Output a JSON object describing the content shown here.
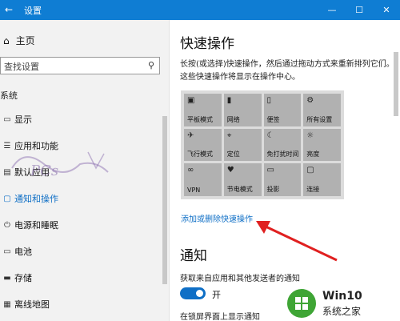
{
  "window": {
    "title": "设置",
    "controls": {
      "minimize": "—",
      "maximize": "☐",
      "close": "✕"
    }
  },
  "sidebar": {
    "home_label": "主页",
    "search_placeholder": "查找设置",
    "group_title": "系统",
    "items": [
      {
        "label": "显示",
        "icon": "display-icon"
      },
      {
        "label": "应用和功能",
        "icon": "apps-icon"
      },
      {
        "label": "默认应用",
        "icon": "default-apps-icon"
      },
      {
        "label": "通知和操作",
        "icon": "notifications-icon",
        "active": true
      },
      {
        "label": "电源和睡眠",
        "icon": "power-icon"
      },
      {
        "label": "电池",
        "icon": "battery-icon"
      },
      {
        "label": "存储",
        "icon": "storage-icon"
      },
      {
        "label": "离线地图",
        "icon": "maps-icon"
      }
    ]
  },
  "main": {
    "quick_actions_title": "快速操作",
    "quick_actions_desc": "长按(或选择)快速操作，然后通过拖动方式来重新排列它们。这些快速操作将显示在操作中心。",
    "tiles": [
      {
        "label": "平板模式",
        "icon": "tablet-icon"
      },
      {
        "label": "网络",
        "icon": "network-icon"
      },
      {
        "label": "便签",
        "icon": "note-icon"
      },
      {
        "label": "所有设置",
        "icon": "gear-icon"
      },
      {
        "label": "飞行模式",
        "icon": "airplane-icon"
      },
      {
        "label": "定位",
        "icon": "location-icon"
      },
      {
        "label": "免打扰时间",
        "icon": "moon-icon"
      },
      {
        "label": "亮度",
        "icon": "brightness-icon"
      },
      {
        "label": "VPN",
        "icon": "vpn-icon"
      },
      {
        "label": "节电模式",
        "icon": "battery-saver-icon"
      },
      {
        "label": "投影",
        "icon": "project-icon"
      },
      {
        "label": "连接",
        "icon": "connect-icon"
      }
    ],
    "add_remove_link": "添加或删除快速操作",
    "notifications_title": "通知",
    "notifications_desc": "获取来自应用和其他发送者的通知",
    "toggle_state": "开",
    "lock_screen_desc": "在锁屏界面上显示通知"
  },
  "watermark": {
    "text": "PCs"
  },
  "brand": {
    "name": "Win10",
    "sub": "系统之家"
  },
  "colors": {
    "accent": "#0f6fc6",
    "titlebar": "#0f7dd3",
    "arrow": "#e02020"
  }
}
